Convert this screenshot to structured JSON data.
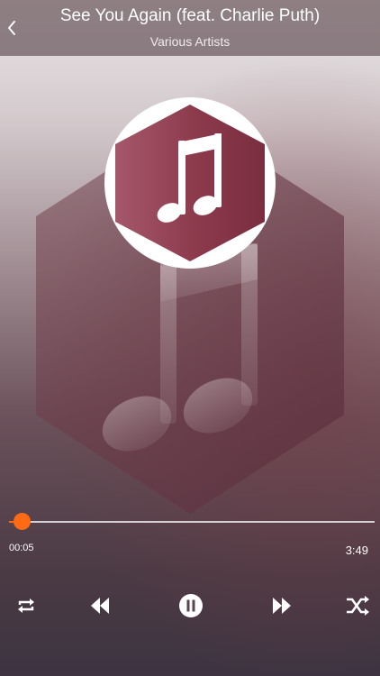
{
  "header": {
    "title": "See You Again (feat. Charlie Puth)",
    "artist": "Various Artists",
    "back_icon": "chevron-left-icon"
  },
  "artwork": {
    "icon": "music-note-icon",
    "accent_color": "#8b3a4c"
  },
  "playback": {
    "elapsed": "00:05",
    "total": "3:49",
    "progress_fraction": 0.022,
    "accent_color": "#ff6a13"
  },
  "controls": [
    {
      "name": "repeat-button",
      "icon": "repeat-icon"
    },
    {
      "name": "rewind-button",
      "icon": "rewind-icon"
    },
    {
      "name": "pause-button",
      "icon": "pause-icon"
    },
    {
      "name": "fast-forward-button",
      "icon": "fast-forward-icon"
    },
    {
      "name": "shuffle-button",
      "icon": "shuffle-icon"
    }
  ]
}
